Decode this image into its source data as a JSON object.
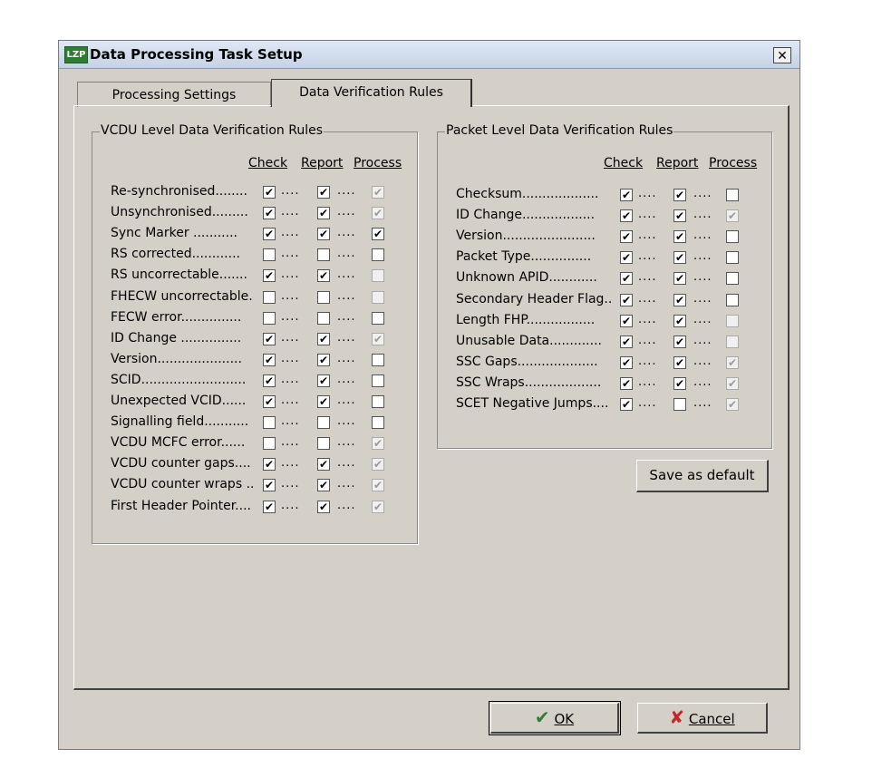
{
  "window": {
    "icon_text": "LZP",
    "title": "Data Processing Task Setup",
    "close_glyph": "✕"
  },
  "tabs": [
    {
      "label": "Processing Settings",
      "active": false
    },
    {
      "label": "Data Verification Rules",
      "active": true
    }
  ],
  "vcdu": {
    "title": "VCDU Level Data Verification Rules",
    "headers": {
      "check": "Check",
      "report": "Report",
      "process": "Process"
    },
    "rows": [
      {
        "label": "Re-synchronised........",
        "check": true,
        "report": true,
        "process": true,
        "process_disabled": true
      },
      {
        "label": "Unsynchronised.........",
        "check": true,
        "report": true,
        "process": true,
        "process_disabled": true
      },
      {
        "label": "Sync Marker ...........",
        "check": true,
        "report": true,
        "process": true,
        "process_disabled": false
      },
      {
        "label": "RS corrected............",
        "check": false,
        "report": false,
        "process": false,
        "process_disabled": false
      },
      {
        "label": "RS uncorrectable.......",
        "check": true,
        "report": true,
        "process": false,
        "process_disabled": true
      },
      {
        "label": "FHECW uncorrectable.",
        "check": false,
        "report": false,
        "process": false,
        "process_disabled": true
      },
      {
        "label": "FECW error...............",
        "check": false,
        "report": false,
        "process": false,
        "process_disabled": false
      },
      {
        "label": "ID Change ...............",
        "check": true,
        "report": true,
        "process": true,
        "process_disabled": true
      },
      {
        "label": "Version.....................",
        "check": true,
        "report": true,
        "process": false,
        "process_disabled": false
      },
      {
        "label": "SCID..........................",
        "check": true,
        "report": true,
        "process": false,
        "process_disabled": false
      },
      {
        "label": "Unexpected VCID......",
        "check": true,
        "report": true,
        "process": false,
        "process_disabled": false
      },
      {
        "label": "Signalling field...........",
        "check": false,
        "report": false,
        "process": false,
        "process_disabled": false
      },
      {
        "label": "VCDU MCFC error......",
        "check": false,
        "report": false,
        "process": true,
        "process_disabled": true
      },
      {
        "label": "VCDU counter gaps....",
        "check": true,
        "report": true,
        "process": true,
        "process_disabled": true
      },
      {
        "label": "VCDU counter wraps ..",
        "check": true,
        "report": true,
        "process": true,
        "process_disabled": true
      },
      {
        "label": "First Header Pointer....",
        "check": true,
        "report": true,
        "process": true,
        "process_disabled": true
      }
    ]
  },
  "packet": {
    "title": "Packet Level Data Verification Rules",
    "headers": {
      "check": "Check",
      "report": "Report",
      "process": "Process"
    },
    "rows": [
      {
        "label": "Checksum...................",
        "check": true,
        "report": true,
        "process": false,
        "process_disabled": false
      },
      {
        "label": "ID Change..................",
        "check": true,
        "report": true,
        "process": true,
        "process_disabled": true
      },
      {
        "label": "Version.......................",
        "check": true,
        "report": true,
        "process": false,
        "process_disabled": false
      },
      {
        "label": "Packet Type...............",
        "check": true,
        "report": true,
        "process": false,
        "process_disabled": false
      },
      {
        "label": "Unknown APID............",
        "check": true,
        "report": true,
        "process": false,
        "process_disabled": false
      },
      {
        "label": "Secondary Header Flag..",
        "check": true,
        "report": true,
        "process": false,
        "process_disabled": false
      },
      {
        "label": "Length FHP.................",
        "check": true,
        "report": true,
        "process": false,
        "process_disabled": true
      },
      {
        "label": "Unusable Data.............",
        "check": true,
        "report": true,
        "process": false,
        "process_disabled": true
      },
      {
        "label": "SSC Gaps....................",
        "check": true,
        "report": true,
        "process": true,
        "process_disabled": true
      },
      {
        "label": "SSC Wraps...................",
        "check": true,
        "report": true,
        "process": true,
        "process_disabled": true
      },
      {
        "label": "SCET Negative Jumps....",
        "check": true,
        "report": false,
        "process": true,
        "process_disabled": true
      }
    ]
  },
  "dots": "....",
  "check_glyph": "✔",
  "buttons": {
    "save_default": "Save as default",
    "ok": "OK",
    "cancel": "Cancel",
    "ok_icon": "✔",
    "cancel_icon": "✘"
  },
  "colors": {
    "ok_icon": "#2e7d32",
    "cancel_icon": "#c62828"
  }
}
